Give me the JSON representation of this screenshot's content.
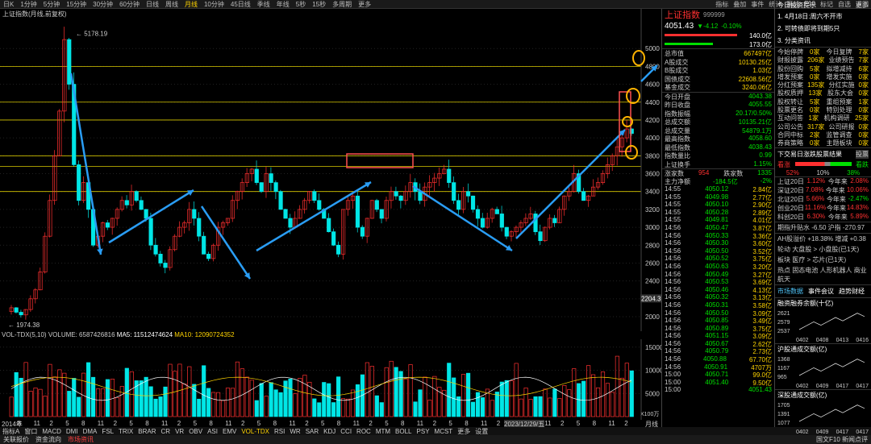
{
  "topbar": {
    "tabs": [
      "日K",
      "1分钟",
      "5分钟",
      "15分钟",
      "30分钟",
      "60分钟",
      "日线",
      "周线",
      "月线",
      "10分钟",
      "45日线",
      "季线",
      "年线",
      "5秒",
      "15秒",
      "多周期",
      "更多"
    ],
    "active_index": 8,
    "right": [
      "指标",
      "叠加",
      "事件",
      "统计",
      "画线",
      "F10",
      "标记",
      "自选",
      "返回"
    ]
  },
  "chart": {
    "title": "上证指数(月线,前复权)",
    "high_label": "5178.19",
    "low_label": "1974.38",
    "price_ticks": [
      "5000",
      "4800",
      "4600",
      "4400",
      "4200",
      "4000",
      "3800",
      "3600",
      "3400",
      "3200",
      "3000",
      "2800",
      "2600",
      "2400",
      "2200",
      "2000"
    ],
    "cursor_value": "2204.3",
    "volume_header": {
      "name": "VOL-TDX(5,10)",
      "volume": "VOLUME: 6587426816",
      "ma5": "MA5: 11512474624",
      "ma10": "MA10: 12090724352"
    },
    "volume_ticks": [
      "15000",
      "10000",
      "5000"
    ],
    "volume_unit": "X100万",
    "x_labels": [
      "2014年",
      "8",
      "11",
      "2",
      "5",
      "8",
      "11",
      "2",
      "5",
      "8",
      "11",
      "2",
      "5",
      "8",
      "11",
      "2",
      "5",
      "8",
      "11",
      "2",
      "5",
      "8",
      "11",
      "2",
      "5",
      "8",
      "11",
      "2",
      "5",
      "8",
      "11",
      "2",
      "5",
      "8",
      "11",
      "2",
      "5",
      "8",
      "11",
      "2"
    ],
    "date_tag": "2023/12/29/五",
    "cycle_label": "月线"
  },
  "bottom_tabs": [
    "指标A",
    "窗口",
    "MACD",
    "DMI",
    "DMA",
    "FSL",
    "TRIX",
    "BRAR",
    "CR",
    "VR",
    "OBV",
    "ASI",
    "EMV",
    "VOL-TDX",
    "RSI",
    "WR",
    "SAR",
    "KDJ",
    "CCI",
    "ROC",
    "MTM",
    "BOLL",
    "PSY",
    "MCST",
    "更多",
    "设置"
  ],
  "status_tabs": [
    "关联报价",
    "资金流向",
    "市场资讯"
  ],
  "status_right": "国文F10 新闻点评",
  "quote": {
    "code": "999999",
    "name": "上证指数",
    "price": "4051.43",
    "change": "▼-4.12",
    "pct": "-0.10%",
    "vol_a": "140.0亿",
    "vol_b": "173.0亿",
    "rows1": [
      [
        "总市值",
        "667497亿"
      ],
      [
        "A股成交",
        "10130.25亿"
      ],
      [
        "B股成交",
        "1.03亿"
      ],
      [
        "国债成交",
        "22608.56亿"
      ],
      [
        "基金成交",
        "3240.06亿"
      ]
    ],
    "rows2": [
      [
        "今日开盘",
        "4043.38"
      ],
      [
        "昨日收盘",
        "4055.55"
      ],
      [
        "指数振幅",
        "20.17/0.50%"
      ],
      [
        "总成交额",
        "10135.21亿"
      ],
      [
        "总成交量",
        "54879.1万"
      ],
      [
        "最高指数",
        "4058.60"
      ],
      [
        "最低指数",
        "4038.43"
      ],
      [
        "指数量比",
        "0.99"
      ],
      [
        "上证换手",
        "1.15%"
      ]
    ],
    "updown": {
      "up_label": "涨家数",
      "up": "954",
      "down_label": "跌家数",
      "down": "1335"
    },
    "netflow": {
      "label": "主力净额",
      "value": "-184.5亿",
      "pct": "-2%"
    },
    "ticks": [
      [
        "14:55",
        "4050.12",
        "2.84亿"
      ],
      [
        "14:55",
        "4049.98",
        "2.77亿"
      ],
      [
        "14:55",
        "4050.10",
        "2.90亿"
      ],
      [
        "14:55",
        "4050.28",
        "2.89亿"
      ],
      [
        "14:55",
        "4049.81",
        "4.01亿"
      ],
      [
        "14:56",
        "4050.47",
        "3.87亿"
      ],
      [
        "14:56",
        "4050.33",
        "3.36亿"
      ],
      [
        "14:56",
        "4050.30",
        "3.60亿"
      ],
      [
        "14:56",
        "4050.50",
        "3.52亿"
      ],
      [
        "14:56",
        "4050.52",
        "3.75亿"
      ],
      [
        "14:56",
        "4050.63",
        "3.20亿"
      ],
      [
        "14:56",
        "4050.49",
        "3.27亿"
      ],
      [
        "14:56",
        "4050.53",
        "3.69亿"
      ],
      [
        "14:56",
        "4050.46",
        "4.13亿"
      ],
      [
        "14:56",
        "4050.32",
        "3.13亿"
      ],
      [
        "14:56",
        "4050.31",
        "3.58亿"
      ],
      [
        "14:56",
        "4050.50",
        "3.09亿"
      ],
      [
        "14:56",
        "4050.85",
        "3.49亿"
      ],
      [
        "14:56",
        "4050.89",
        "3.75亿"
      ],
      [
        "14:56",
        "4051.15",
        "3.09亿"
      ],
      [
        "14:56",
        "4050.67",
        "2.62亿"
      ],
      [
        "14:56",
        "4050.79",
        "2.73亿"
      ],
      [
        "14:56",
        "4050.88",
        "67.70亿"
      ],
      [
        "14:56",
        "4050.91",
        "4707万"
      ],
      [
        "15:00",
        "4050.71",
        "99.0亿"
      ],
      [
        "15:00",
        "4051.40",
        "9.50亿"
      ],
      [
        "15:00",
        "4051.43"
      ]
    ]
  },
  "news": {
    "title": "今日投资提示",
    "more": "更多",
    "items": [
      "1. 4月18日:周六不开市",
      "2. 可转债即将到期5只",
      "3. 分类资讯"
    ],
    "stats": [
      [
        "今始停牌",
        "0家",
        "今日复牌",
        "7家"
      ],
      [
        "财报披露",
        "206家",
        "业绩预告",
        "7家"
      ],
      [
        "股份回购",
        "5家",
        "拟增减持",
        "6家"
      ],
      [
        "增发预案",
        "0家",
        "增发实施",
        "0家"
      ],
      [
        "分红预案",
        "135家",
        "分红实施",
        "0家"
      ],
      [
        "股权质押",
        "13家",
        "股东大会",
        "0家"
      ],
      [
        "股权转让",
        "5家",
        "重组预案",
        "1家"
      ],
      [
        "股票更名",
        "0家",
        "特别处理",
        "0家"
      ],
      [
        "互动问答",
        "1家",
        "机构调研",
        "25家"
      ],
      [
        "公司公告",
        "317家",
        "公司研报",
        "0家"
      ],
      [
        "合同中标",
        "2家",
        "监管调查",
        "0家"
      ],
      [
        "券商策略",
        "0家",
        "主题板块",
        "0家"
      ]
    ],
    "breadth": {
      "title": "下交易日涨跌股票结果",
      "btn": "投票",
      "up": "看涨",
      "down": "看跌",
      "up_pct": "52%",
      "flat": "10%",
      "down_pct": "38%"
    },
    "indices": [
      [
        "上证20日",
        "1.12%",
        "今年来",
        "2.08%"
      ],
      [
        "深证20日",
        "7.08%",
        "今年来",
        "10.06%"
      ],
      [
        "北证20日",
        "5.66%",
        "今年来",
        "-2.47%"
      ],
      [
        "创业20日",
        "11.16%",
        "今年来",
        "14.83%"
      ],
      [
        "科创20日",
        "6.30%",
        "今年来",
        "5.89%"
      ]
    ],
    "futures": "期指升贴水 -6.50 沪指 -270.97",
    "ah": "AH股溢价 +18.38% 增减 +0.38",
    "rotation": [
      "轮动 大盘股 > 小盘股(已1天)",
      "板块 医疗 > 芯片(已1天)",
      "热点 固态电池 人形机器人 商业航天"
    ],
    "links": [
      "市场数据",
      "事件会议",
      "趋势财经"
    ],
    "mini": [
      {
        "title": "融资融券余额(十亿)",
        "vals": [
          "2621",
          "2579",
          "2537"
        ],
        "x": [
          "0402",
          "0408",
          "0413",
          "0416"
        ]
      },
      {
        "title": "沪股通成交额(亿)",
        "vals": [
          "1368",
          "1167",
          "965"
        ],
        "x": [
          "0402",
          "0409",
          "0417",
          "0417"
        ]
      },
      {
        "title": "深股通成交额(亿)",
        "vals": [
          "1705",
          "1391",
          "1077"
        ],
        "x": [
          "0402",
          "0409",
          "0417",
          "0417"
        ]
      }
    ]
  }
}
